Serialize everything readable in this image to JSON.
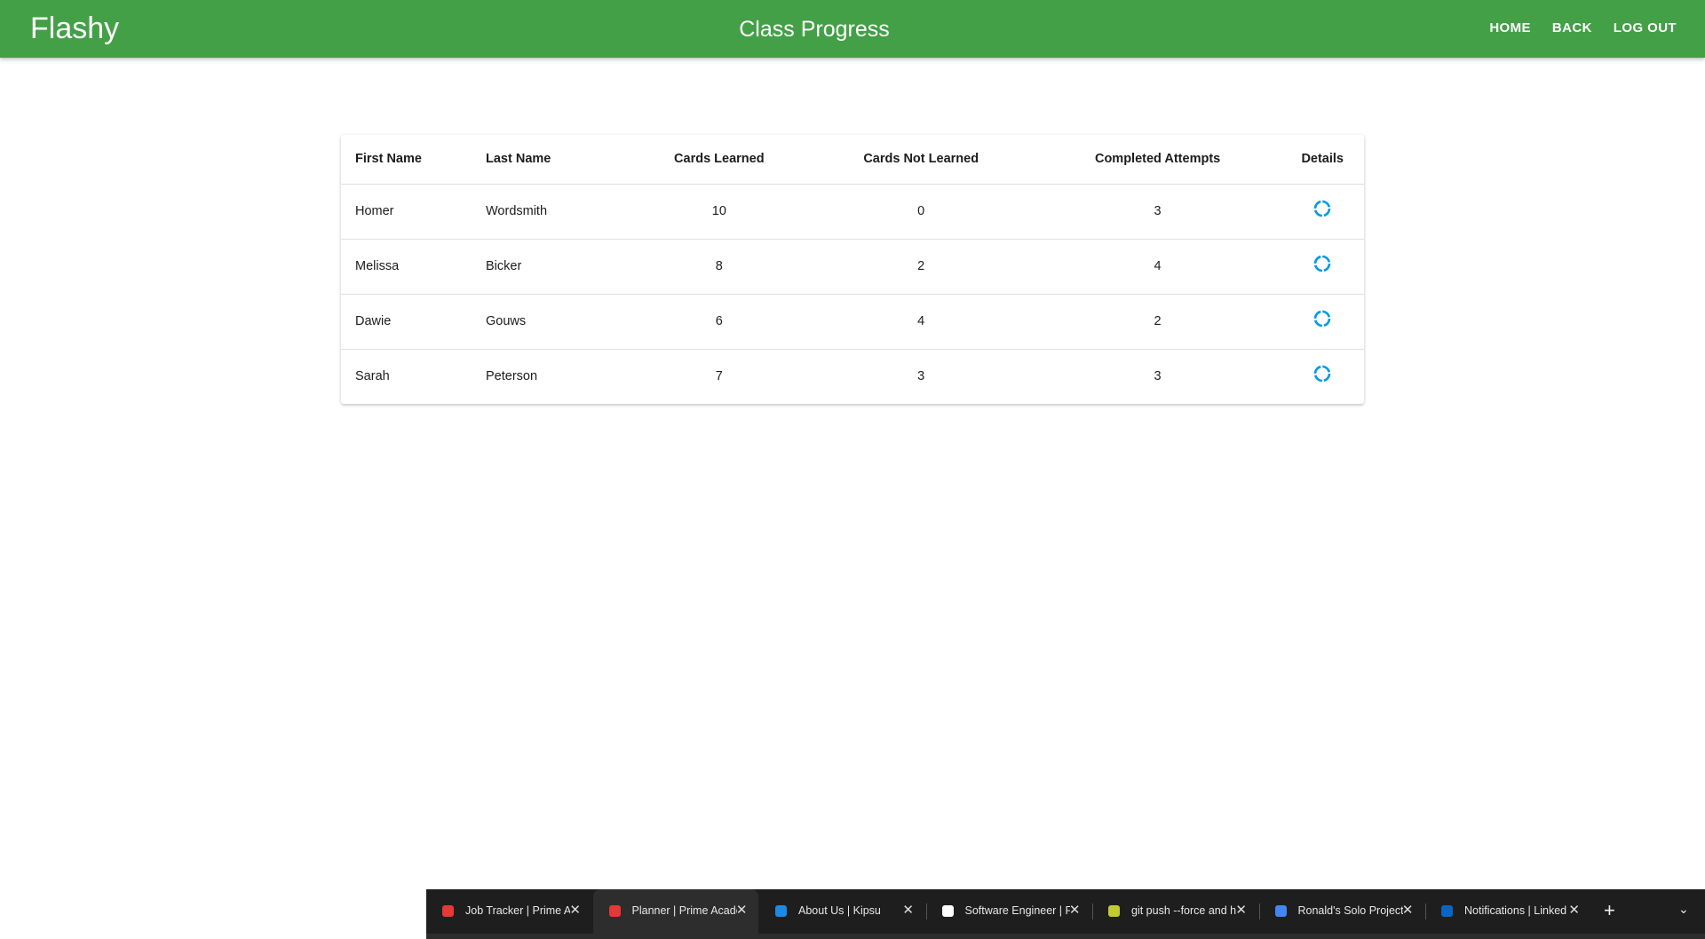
{
  "app": {
    "brand": "Flashy",
    "title": "Class Progress",
    "nav": [
      "HOME",
      "BACK",
      "LOG OUT"
    ]
  },
  "table": {
    "headers": [
      "First Name",
      "Last Name",
      "Cards Learned",
      "Cards Not Learned",
      "Completed Attempts",
      "Details"
    ],
    "rows": [
      {
        "first": "Homer",
        "last": "Wordsmith",
        "learned": "10",
        "not_learned": "0",
        "attempts": "3"
      },
      {
        "first": "Melissa",
        "last": "Bicker",
        "learned": "8",
        "not_learned": "2",
        "attempts": "4"
      },
      {
        "first": "Dawie",
        "last": "Gouws",
        "learned": "6",
        "not_learned": "4",
        "attempts": "2"
      },
      {
        "first": "Sarah",
        "last": "Peterson",
        "learned": "7",
        "not_learned": "3",
        "attempts": "3"
      }
    ],
    "details_icon": "progress-circle-icon",
    "details_icon_color": "#039be5"
  },
  "colors": {
    "appbar": "#43a047",
    "tabstrip": "#1e1e1e"
  },
  "browser_tabs": [
    {
      "label": "Job Tracker | Prime Ac",
      "favicon": "prime-academy-icon",
      "color": "#e53935"
    },
    {
      "label": "Planner | Prime Acade",
      "favicon": "prime-academy-icon",
      "color": "#e53935",
      "active": true
    },
    {
      "label": "About Us | Kipsu",
      "favicon": "kipsu-icon",
      "color": "#1e88e5"
    },
    {
      "label": "Software Engineer | Fi",
      "favicon": "document-icon",
      "color": "#ffffff"
    },
    {
      "label": "git push --force and h",
      "favicon": "git-icon",
      "color": "#c0ca33"
    },
    {
      "label": "Ronald's Solo Project",
      "favicon": "google-docs-icon",
      "color": "#4285f4"
    },
    {
      "label": "Notifications | Linked",
      "favicon": "linkedin-icon",
      "color": "#0a66c2"
    }
  ]
}
